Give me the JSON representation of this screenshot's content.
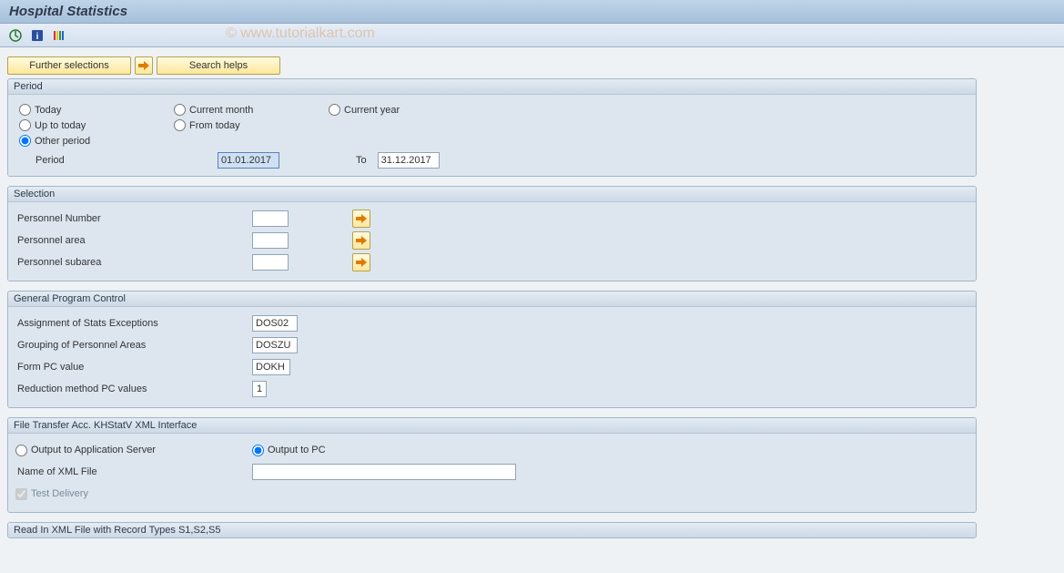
{
  "title": "Hospital Statistics",
  "watermark": "© www.tutorialkart.com",
  "toolbar": {
    "execute_icon": "execute-icon",
    "info_icon": "object-info-icon",
    "variant_icon": "variants-icon"
  },
  "buttons": {
    "further_selections": "Further selections",
    "search_helps": "Search helps"
  },
  "period": {
    "legend": "Period",
    "today": "Today",
    "up_to_today": "Up to today",
    "other_period": "Other period",
    "current_month": "Current month",
    "from_today": "From today",
    "current_year": "Current year",
    "period_label": "Period",
    "from_value": "01.01.2017",
    "to_label": "To",
    "to_value": "31.12.2017",
    "selected": "other_period"
  },
  "selection": {
    "legend": "Selection",
    "rows": [
      {
        "label": "Personnel Number",
        "value": ""
      },
      {
        "label": "Personnel area",
        "value": ""
      },
      {
        "label": "Personnel subarea",
        "value": ""
      }
    ]
  },
  "general": {
    "legend": "General Program Control",
    "rows": [
      {
        "label": "Assignment of Stats Exceptions",
        "value": "DOS02"
      },
      {
        "label": "Grouping of Personnel Areas",
        "value": "DOSZU"
      },
      {
        "label": "Form PC value",
        "value": "DOKH"
      },
      {
        "label": "Reduction method PC values",
        "value": "1"
      }
    ]
  },
  "file_transfer": {
    "legend": "File Transfer Acc. KHStatV XML Interface",
    "output_server": "Output to Application Server",
    "output_pc": "Output to PC",
    "selected": "pc",
    "xml_label": "Name of XML File",
    "xml_value": "",
    "test_delivery": "Test Delivery",
    "test_delivery_checked": true
  },
  "readin": {
    "legend": "Read In XML File with Record Types S1,S2,S5"
  }
}
